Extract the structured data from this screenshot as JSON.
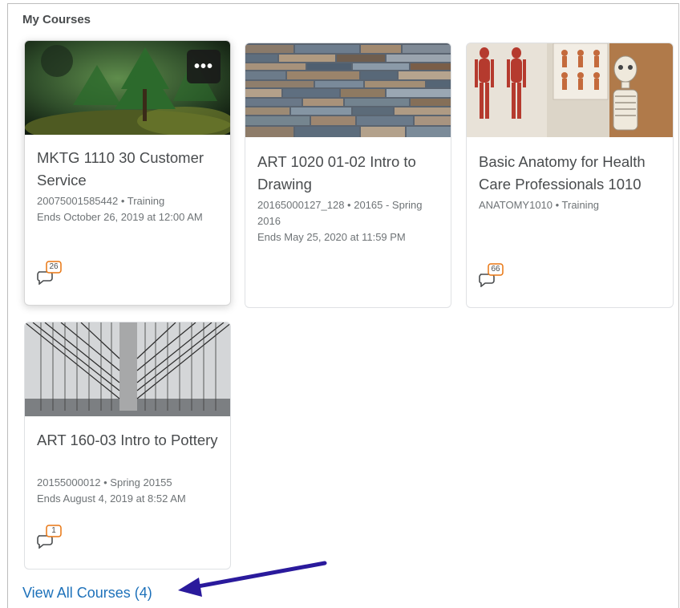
{
  "widget": {
    "title": "My Courses"
  },
  "courses": [
    {
      "title": "MKTG 1110 30 Customer Service",
      "line1": "20075001585442 • Training",
      "line2": "Ends October 26, 2019 at 12:00 AM",
      "badge": "26",
      "image": "forest"
    },
    {
      "title": "ART 1020 01-02 Intro to Drawing",
      "line1": "20165000127_128 • 20165 - Spring 2016",
      "line2": "Ends May 25, 2020 at 11:59 PM",
      "badge": "",
      "image": "stone-wall"
    },
    {
      "title": "Basic Anatomy for Health Care Professionals 1010",
      "line1": "ANATOMY1010 • Training",
      "line2": "",
      "badge": "66",
      "image": "anatomy-classroom"
    },
    {
      "title": "ART 160-03 Intro to Pottery",
      "line1": "20155000012 • Spring 20155",
      "line2": "Ends August 4, 2019 at 8:52 AM",
      "badge": "1",
      "image": "bridge-cables"
    }
  ],
  "more_button": {
    "label": "•••"
  },
  "footer": {
    "view_all_label": "View All Courses (4)"
  },
  "colors": {
    "link": "#1d71ba",
    "badge": "#e87511",
    "arrow": "#2a1a9c"
  }
}
